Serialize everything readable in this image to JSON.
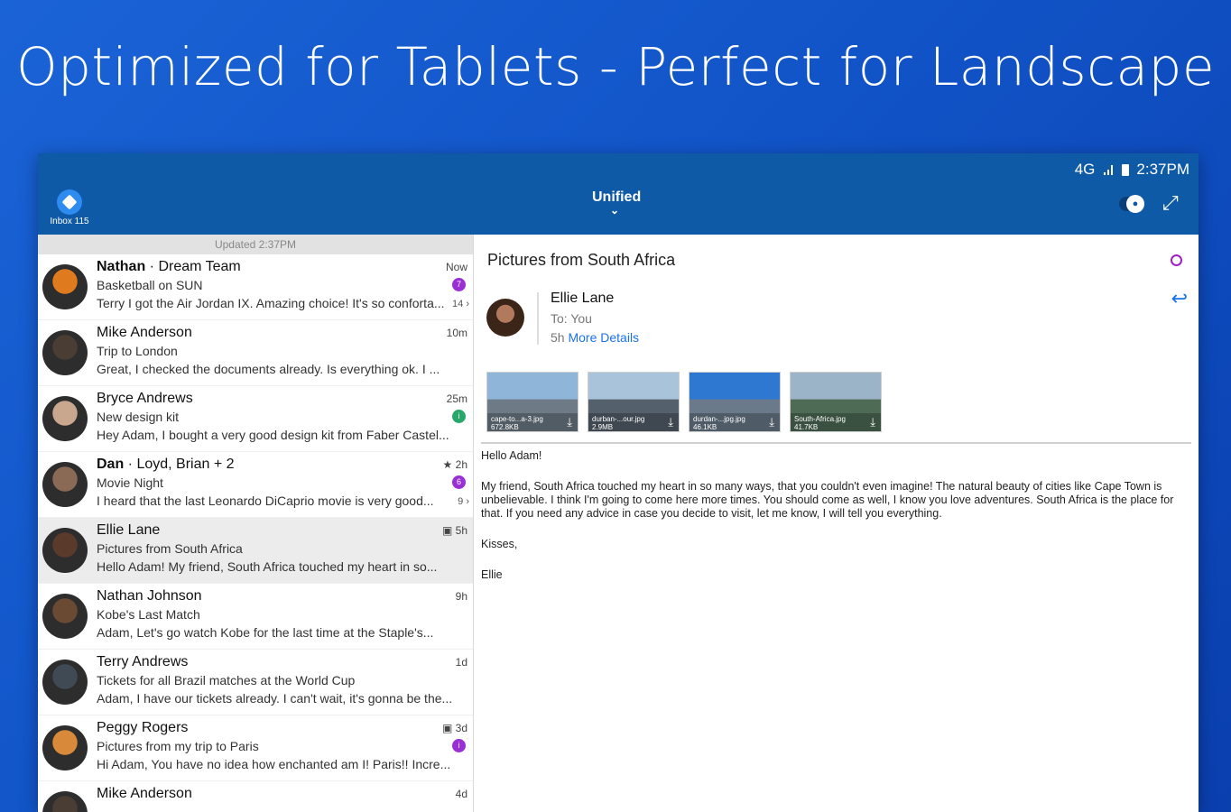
{
  "headline": "Optimized for Tablets - Perfect for Landscape",
  "status": {
    "network": "4G",
    "time": "2:37PM"
  },
  "toolbar": {
    "inbox_label": "Inbox",
    "inbox_count": "115",
    "title": "Unified"
  },
  "list": {
    "updated": "Updated 2:37PM",
    "rows": [
      {
        "name": "Nathan",
        "sep": " · ",
        "group": "Dream Team",
        "subject": "Basketball on SUN",
        "preview": "Terry I got the Air Jordan IX. Amazing choice! It's so conforta...",
        "time": "Now",
        "badge": "7",
        "badge_color": "#9b2fd6",
        "count": "14 ›",
        "avatar_color": "#e07a1e"
      },
      {
        "name": "Mike Anderson",
        "subject": "Trip to London",
        "preview": "Great, I checked the documents already. Is everything ok. I ...",
        "time": "10m",
        "avatar_color": "#4a3d34"
      },
      {
        "name": "Bryce Andrews",
        "subject": "New design kit",
        "preview": "Hey Adam, I bought a very good design kit from Faber Castel...",
        "time": "25m",
        "badge": "i",
        "badge_color": "#27a86a",
        "avatar_color": "#c9a78e"
      },
      {
        "name": "Dan",
        "sep": " · ",
        "group": "Loyd, Brian + 2",
        "subject": "Movie Night",
        "preview": "I heard that the last Leonardo DiCaprio movie is very good...",
        "time": "★ 2h",
        "badge": "6",
        "badge_color": "#9b2fd6",
        "count": "9 ›",
        "avatar_color": "#8a6a55"
      },
      {
        "name": "Ellie Lane",
        "subject": "Pictures from South Africa",
        "preview": "Hello Adam! My friend, South Africa touched my heart in so...",
        "time": "▣ 5h",
        "avatar_color": "#5a3a2a",
        "selected": true
      },
      {
        "name": "Nathan Johnson",
        "subject": "Kobe's Last Match",
        "preview": "Adam, Let's go watch Kobe for the last time at the Staple's...",
        "time": "9h",
        "avatar_color": "#6b4a33"
      },
      {
        "name": "Terry Andrews",
        "subject": "Tickets for all Brazil matches at the World Cup",
        "preview": "Adam, I have our tickets already. I can't wait, it's gonna be the...",
        "time": "1d",
        "avatar_color": "#3f4a55"
      },
      {
        "name": "Peggy Rogers",
        "subject": "Pictures from my trip to Paris",
        "preview": "Hi Adam, You have no idea how enchanted am I! Paris!! Incre...",
        "time": "▣ 3d",
        "badge": "i",
        "badge_color": "#9b2fd6",
        "avatar_color": "#d88a3a"
      },
      {
        "name": "Mike Anderson",
        "subject": "",
        "preview": "",
        "time": "4d",
        "avatar_color": "#4a3d34"
      }
    ]
  },
  "reader": {
    "subject": "Pictures from South Africa",
    "from": "Ellie Lane",
    "to_label": "To:",
    "to": "You",
    "age": "5h",
    "details": "More Details",
    "attachments": [
      {
        "name": "cape-to...a-3.jpg",
        "size": "672.8KB",
        "sky": "#8fb6d8",
        "land": "#6e7b86"
      },
      {
        "name": "durban-...our.jpg",
        "size": "2.9MB",
        "sky": "#a9c4da",
        "land": "#54606c"
      },
      {
        "name": "durdan-...jpg.jpg",
        "size": "46.1KB",
        "sky": "#2f78d2",
        "land": "#6a7a8a"
      },
      {
        "name": "South-Africa.jpg",
        "size": "41.7KB",
        "sky": "#9bb4c8",
        "land": "#4e6b56"
      }
    ],
    "body": [
      "Hello Adam!",
      "My friend, South Africa touched my heart in so many ways, that you couldn't even imagine! The natural beauty of cities like Cape Town is unbelievable. I think I'm going to come here more times. You should come as well, I know you love adventures. South Africa is the place for that. If you need any advice in case you decide to visit, let me know, I will tell you everything.",
      "Kisses,",
      "Ellie"
    ]
  }
}
